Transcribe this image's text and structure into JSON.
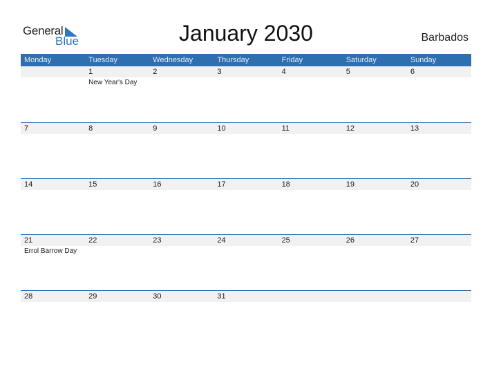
{
  "logo": {
    "text_general": "General",
    "text_blue": "Blue"
  },
  "title": "January 2030",
  "country": "Barbados",
  "colors": {
    "header_bg": "#2e6fb0",
    "accent": "#2a79c4",
    "daybar_bg": "#f1f1f1"
  },
  "weekdays": [
    "Monday",
    "Tuesday",
    "Wednesday",
    "Thursday",
    "Friday",
    "Saturday",
    "Sunday"
  ],
  "weeks": [
    {
      "days": [
        "",
        "1",
        "2",
        "3",
        "4",
        "5",
        "6"
      ],
      "events": [
        "",
        "New Year's Day",
        "",
        "",
        "",
        "",
        ""
      ]
    },
    {
      "days": [
        "7",
        "8",
        "9",
        "10",
        "11",
        "12",
        "13"
      ],
      "events": [
        "",
        "",
        "",
        "",
        "",
        "",
        ""
      ]
    },
    {
      "days": [
        "14",
        "15",
        "16",
        "17",
        "18",
        "19",
        "20"
      ],
      "events": [
        "",
        "",
        "",
        "",
        "",
        "",
        ""
      ]
    },
    {
      "days": [
        "21",
        "22",
        "23",
        "24",
        "25",
        "26",
        "27"
      ],
      "events": [
        "Errol Barrow Day",
        "",
        "",
        "",
        "",
        "",
        ""
      ]
    },
    {
      "days": [
        "28",
        "29",
        "30",
        "31",
        "",
        "",
        ""
      ],
      "events": [
        "",
        "",
        "",
        "",
        "",
        "",
        ""
      ]
    }
  ]
}
